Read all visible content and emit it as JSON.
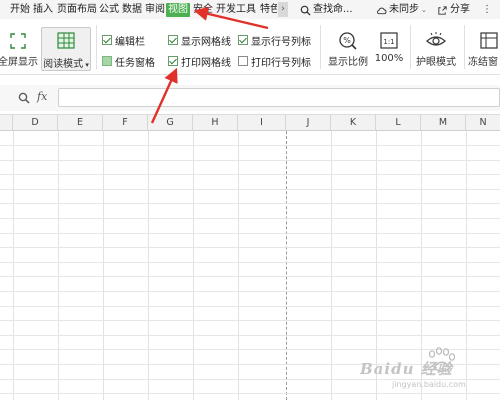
{
  "menu": {
    "tabs": [
      {
        "label": "开始"
      },
      {
        "label": "插入"
      },
      {
        "label": "页面布局"
      },
      {
        "label": "公式"
      },
      {
        "label": "数据"
      },
      {
        "label": "审阅"
      },
      {
        "label": "视图",
        "active": true
      },
      {
        "label": "安全"
      },
      {
        "label": "开发工具"
      },
      {
        "label": "特色"
      }
    ],
    "search_label": "查找命...",
    "sync_label": "未同步",
    "share_label": "分享"
  },
  "ribbon": {
    "fullscreen_label": "全屏显示",
    "reading_mode_label": "阅读模式",
    "checkboxes": {
      "edit_bar": {
        "label": "编辑栏",
        "checked": true
      },
      "task_pane": {
        "label": "任务窗格",
        "checked": false
      },
      "show_gridlines": {
        "label": "显示网格线",
        "checked": true
      },
      "print_gridlines": {
        "label": "打印网格线",
        "checked": true
      },
      "show_row_col_headers": {
        "label": "显示行号列标",
        "checked": true
      },
      "print_row_col_headers": {
        "label": "打印行号列标",
        "checked": false
      }
    },
    "zoom_label": "显示比例",
    "zoom_100_label": "100%",
    "zoom_100_icon_text": "1:1",
    "eye_mode_label": "护眼模式",
    "freeze_label": "冻结窗"
  },
  "formula_bar": {
    "fx_label": "fx",
    "value": ""
  },
  "grid": {
    "columns": [
      "D",
      "E",
      "F",
      "G",
      "H",
      "I",
      "J",
      "K",
      "L",
      "M",
      "N"
    ]
  },
  "watermark": {
    "text": "Baidu 经验",
    "sub": "jingyan.baidu.com"
  },
  "colors": {
    "active_tab": "#4caf50",
    "annotation_arrow": "#e0312a",
    "checkbox_check": "#2e7d32"
  }
}
